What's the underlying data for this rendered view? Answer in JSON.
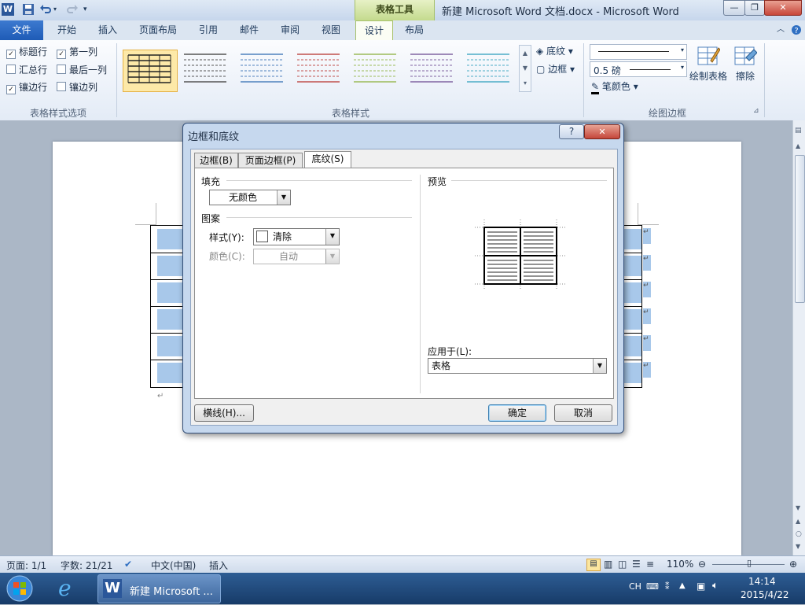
{
  "titlebar": {
    "contextual_group": "表格工具",
    "window_title": "新建 Microsoft Word 文档.docx  -  Microsoft Word",
    "buttons": {
      "minimize": "—",
      "restore": "❐",
      "close": "✕"
    }
  },
  "tabs": {
    "file": "文件",
    "items": [
      "开始",
      "插入",
      "页面布局",
      "引用",
      "邮件",
      "审阅",
      "视图",
      "设计",
      "布局"
    ],
    "active": "设计"
  },
  "ribbon": {
    "options": {
      "header_row": "标题行",
      "first_column": "第一列",
      "total_row": "汇总行",
      "last_column": "最后一列",
      "banded_rows": "镶边行",
      "banded_columns": "镶边列",
      "group_label": "表格样式选项"
    },
    "styles": {
      "group_label": "表格样式",
      "shading": "底纹",
      "borders": "边框",
      "swatch_colors": [
        "#222222",
        "#555555",
        "#4f81bd",
        "#c0504d",
        "#9bbb59",
        "#8064a2",
        "#4bacc6"
      ]
    },
    "draw": {
      "line_weight": "0.5 磅",
      "pen_color": "笔颜色",
      "draw_table": "绘制表格",
      "eraser": "擦除",
      "group_label": "绘图边框"
    }
  },
  "dialog": {
    "title": "边框和底纹",
    "help": "?",
    "close": "✕",
    "tabs": [
      "边框(B)",
      "页面边框(P)",
      "底纹(S)"
    ],
    "fill": {
      "label": "填充",
      "value": "无颜色"
    },
    "pattern": {
      "label": "图案",
      "style_label": "样式(Y):",
      "style_value": "清除",
      "color_label": "颜色(C):",
      "color_value": "自动"
    },
    "preview": {
      "label": "预览"
    },
    "apply_to": {
      "label": "应用于(L):",
      "value": "表格"
    },
    "buttons": {
      "horizontal_line": "横线(H)...",
      "ok": "确定",
      "cancel": "取消"
    }
  },
  "statusbar": {
    "page": "页面: 1/1",
    "words": "字数: 21/21",
    "language": "中文(中国)",
    "mode": "插入",
    "zoom": "110%"
  },
  "taskbar": {
    "word_task": "新建 Microsoft ...",
    "ime": "CH",
    "time": "14:14",
    "date": "2015/4/22"
  }
}
